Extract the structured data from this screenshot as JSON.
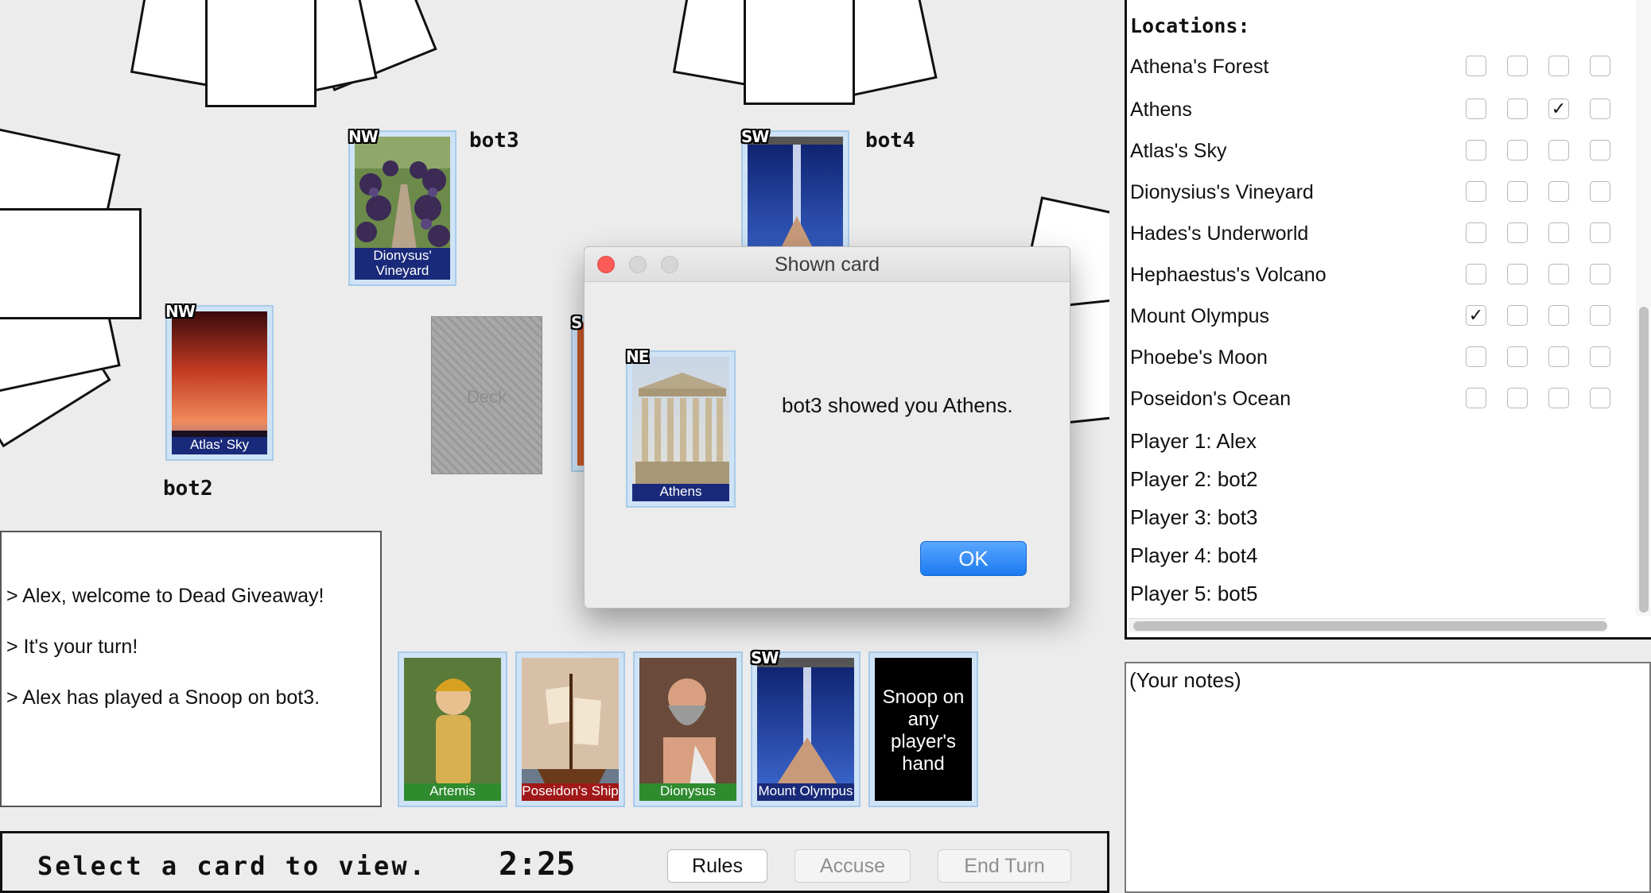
{
  "players_area": {
    "bot3": {
      "label": "bot3",
      "card_tag": "NW",
      "card_name": "Dionysus' Vineyard"
    },
    "bot4": {
      "label": "bot4",
      "card_tag": "SW",
      "card_name": ""
    },
    "bot2": {
      "label": "bot2",
      "card_tag": "NW",
      "card_name": "Atlas' Sky"
    },
    "partial_tag": "S"
  },
  "deck_label": "Deck",
  "log": [
    "> Alex, welcome to Dead Giveaway!",
    "> It's your turn!",
    "> Alex has played a Snoop on bot3."
  ],
  "hand": [
    {
      "name": "Artemis",
      "caption_color": "#2e8b2e",
      "tag": ""
    },
    {
      "name": "Poseidon's Ship",
      "caption_color": "#a01818",
      "tag": ""
    },
    {
      "name": "Dionysus",
      "caption_color": "#2e8b2e",
      "tag": ""
    },
    {
      "name": "Mount Olympus",
      "caption_color": "#1a2a7a",
      "tag": "SW"
    }
  ],
  "action_card": {
    "text": "Snoop on any player's hand"
  },
  "status": {
    "message": "Select a card to view.",
    "timer": "2:25"
  },
  "buttons": {
    "rules": "Rules",
    "accuse": "Accuse",
    "end_turn": "End Turn"
  },
  "locations": {
    "title": "Locations:",
    "rows": [
      {
        "name": "Athena's Forest",
        "checks": [
          false,
          false,
          false,
          false
        ]
      },
      {
        "name": "Athens",
        "checks": [
          false,
          false,
          true,
          false
        ]
      },
      {
        "name": "Atlas's Sky",
        "checks": [
          false,
          false,
          false,
          false
        ]
      },
      {
        "name": "Dionysius's Vineyard",
        "checks": [
          false,
          false,
          false,
          false
        ]
      },
      {
        "name": "Hades's Underworld",
        "checks": [
          false,
          false,
          false,
          false
        ]
      },
      {
        "name": "Hephaestus's Volcano",
        "checks": [
          false,
          false,
          false,
          false
        ]
      },
      {
        "name": "Mount Olympus",
        "checks": [
          true,
          false,
          false,
          false
        ]
      },
      {
        "name": "Phoebe's Moon",
        "checks": [
          false,
          false,
          false,
          false
        ]
      },
      {
        "name": "Poseidon's Ocean",
        "checks": [
          false,
          false,
          false,
          false
        ]
      }
    ],
    "players": [
      "Player 1: Alex",
      "Player 2: bot2",
      "Player 3: bot3",
      "Player 4: bot4",
      "Player 5: bot5"
    ]
  },
  "notes_placeholder": "(Your notes)",
  "dialog": {
    "title": "Shown card",
    "card_tag": "NE",
    "card_name": "Athens",
    "message": "bot3 showed you Athens.",
    "ok": "OK"
  },
  "colors": {
    "accent_blue": "#1b7af0",
    "caption_navy": "#1a2a7a",
    "card_frame": "#a9cbe8"
  }
}
